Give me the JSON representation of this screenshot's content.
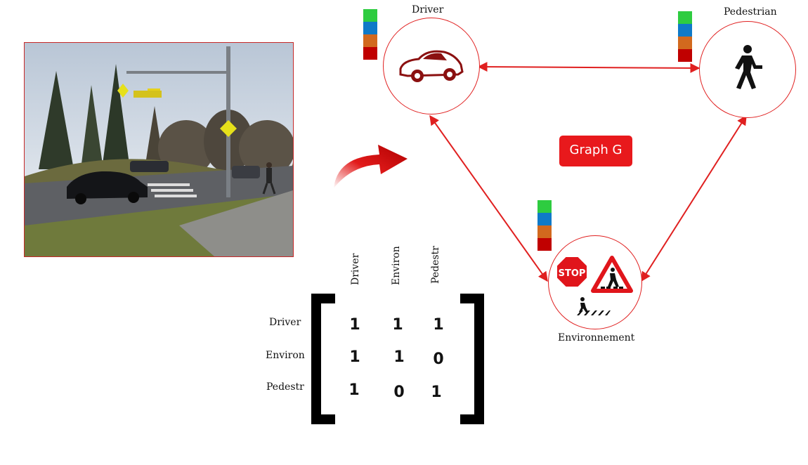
{
  "nodes": {
    "driver": {
      "label": "Driver",
      "icon": "car-icon"
    },
    "pedestrian": {
      "label": "Pedestrian",
      "icon": "walking-person-icon"
    },
    "environment": {
      "label": "Environnement",
      "icons": [
        "stop-sign-icon",
        "pedestrian-crossing-sign-icon",
        "crosswalk-icon"
      ],
      "stop_text": "STOP"
    }
  },
  "graph_badge": {
    "label": "Graph G",
    "color": "#e8191c"
  },
  "feature_colors": [
    "#2ecc40",
    "#0f7ac8",
    "#d2691e",
    "#c00000"
  ],
  "edge_color": "#e02020",
  "photo": {
    "description_icon": "street-crossing-photo"
  },
  "matrix": {
    "row_labels": [
      "Driver",
      "Environ",
      "Pedestr"
    ],
    "col_labels": [
      "Driver",
      "Environ",
      "Pedestr"
    ],
    "values": [
      [
        1,
        1,
        1
      ],
      [
        1,
        1,
        0
      ],
      [
        1,
        0,
        1
      ]
    ]
  }
}
